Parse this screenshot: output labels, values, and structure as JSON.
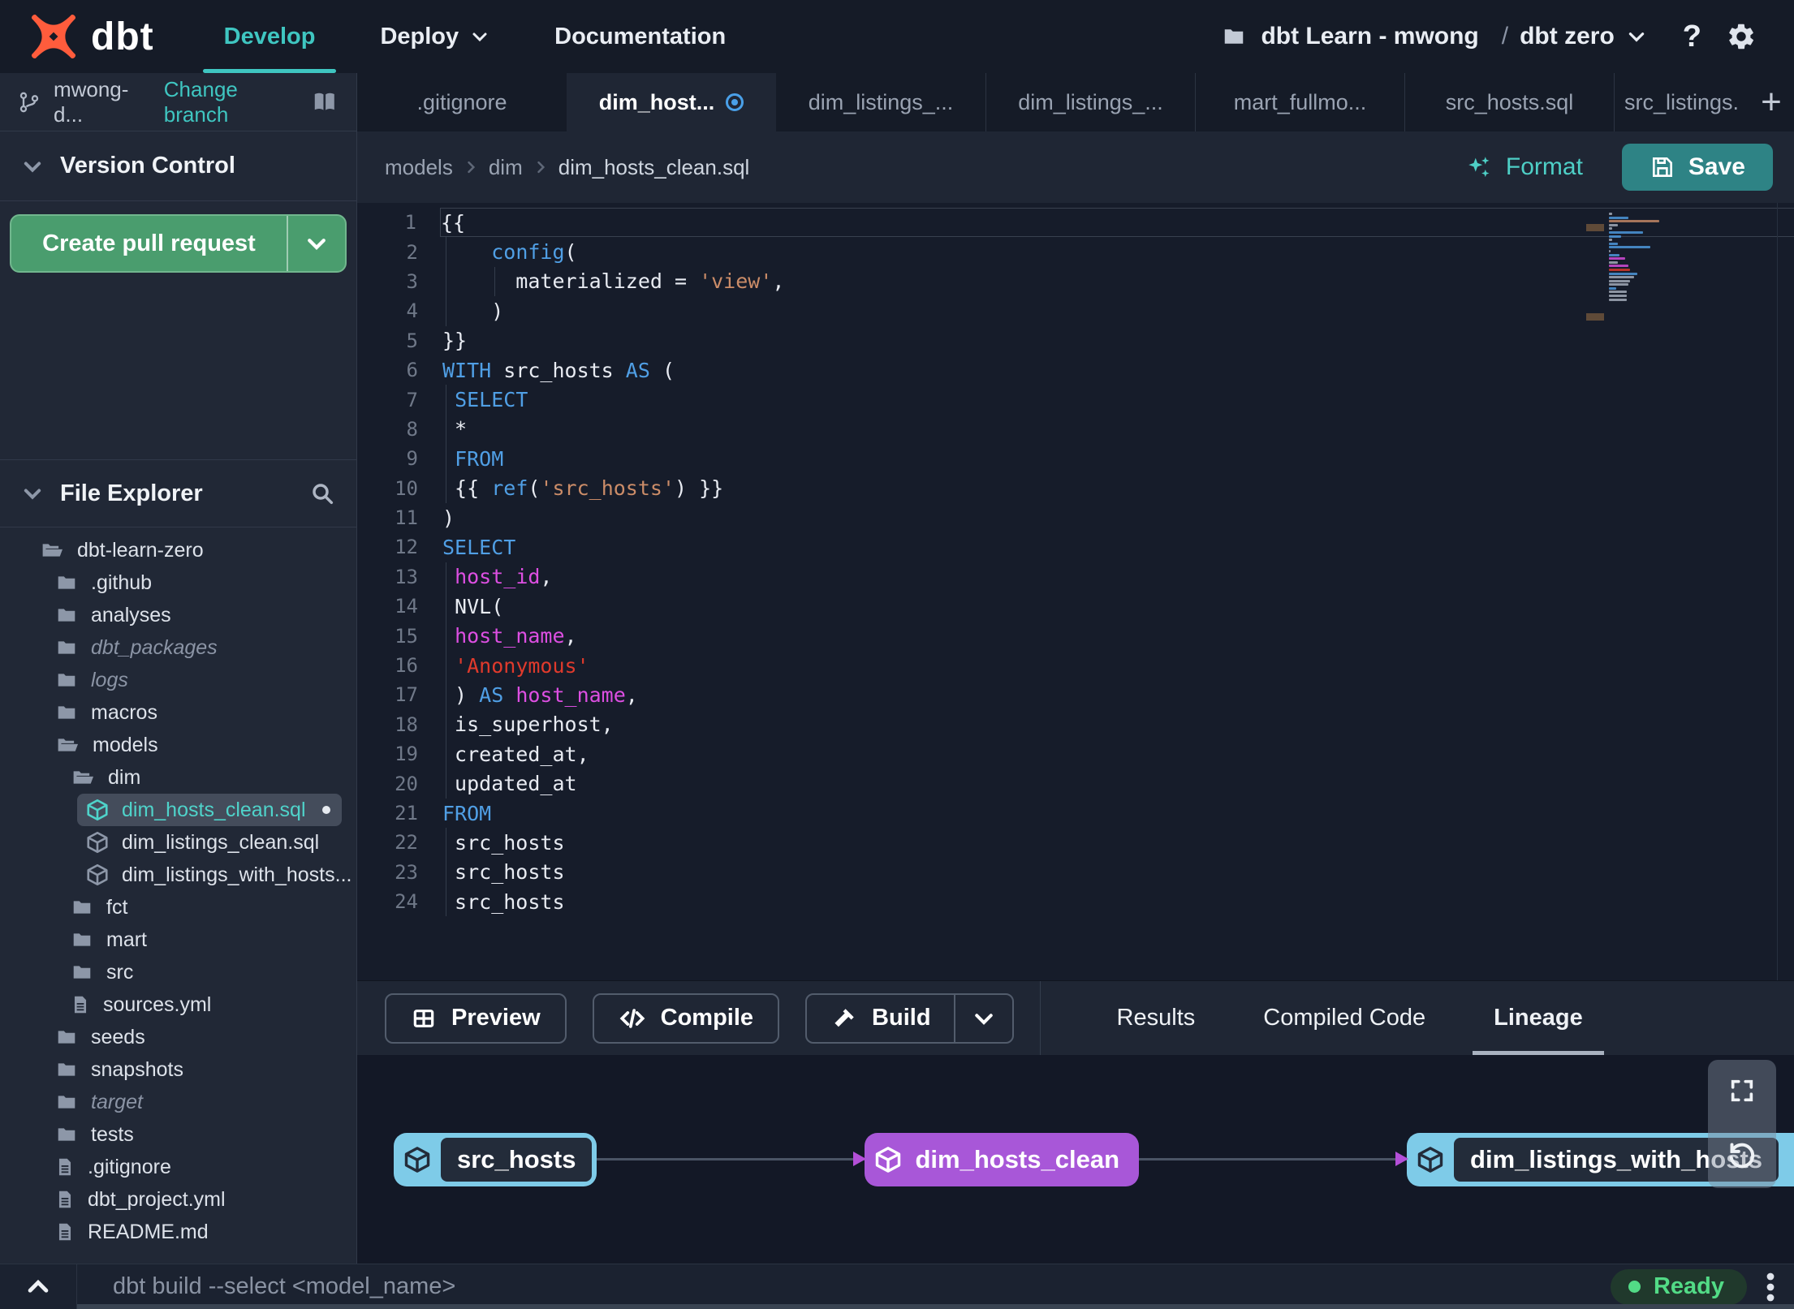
{
  "topnav": {
    "logo_text": "dbt",
    "items": [
      {
        "label": "Develop",
        "active": true
      },
      {
        "label": "Deploy",
        "dropdown": true
      },
      {
        "label": "Documentation"
      }
    ],
    "project_label": "dbt Learn - mwong",
    "separator": "/",
    "environment_label": "dbt zero",
    "help_label": "?"
  },
  "sidebar": {
    "branch_name": "mwong-d...",
    "change_branch_label": "Change branch",
    "version_control_title": "Version Control",
    "create_pr_label": "Create pull request",
    "file_explorer_title": "File Explorer",
    "tree": [
      {
        "label": "dbt-learn-zero",
        "icon": "folder-open",
        "level": 0
      },
      {
        "label": ".github",
        "icon": "folder",
        "level": 1
      },
      {
        "label": "analyses",
        "icon": "folder",
        "level": 1
      },
      {
        "label": "dbt_packages",
        "icon": "folder",
        "level": 1,
        "italic": true
      },
      {
        "label": "logs",
        "icon": "folder",
        "level": 1,
        "italic": true
      },
      {
        "label": "macros",
        "icon": "folder",
        "level": 1
      },
      {
        "label": "models",
        "icon": "folder-open",
        "level": 1
      },
      {
        "label": "dim",
        "icon": "folder-open",
        "level": 2
      },
      {
        "label": "dim_hosts_clean.sql",
        "icon": "model",
        "level": 3,
        "selected": true,
        "modified": true
      },
      {
        "label": "dim_listings_clean.sql",
        "icon": "model",
        "level": 3
      },
      {
        "label": "dim_listings_with_hosts...",
        "icon": "model",
        "level": 3
      },
      {
        "label": "fct",
        "icon": "folder",
        "level": 2
      },
      {
        "label": "mart",
        "icon": "folder",
        "level": 2
      },
      {
        "label": "src",
        "icon": "folder",
        "level": 2
      },
      {
        "label": "sources.yml",
        "icon": "file",
        "level": 2
      },
      {
        "label": "seeds",
        "icon": "folder",
        "level": 1
      },
      {
        "label": "snapshots",
        "icon": "folder",
        "level": 1
      },
      {
        "label": "target",
        "icon": "folder",
        "level": 1,
        "italic": true
      },
      {
        "label": "tests",
        "icon": "folder",
        "level": 1
      },
      {
        "label": ".gitignore",
        "icon": "file",
        "level": 1
      },
      {
        "label": "dbt_project.yml",
        "icon": "file",
        "level": 1
      },
      {
        "label": "README.md",
        "icon": "file",
        "level": 1
      }
    ]
  },
  "tabs": [
    {
      "label": ".gitignore"
    },
    {
      "label": "dim_host...",
      "active": true,
      "modified": true
    },
    {
      "label": "dim_listings_..."
    },
    {
      "label": "dim_listings_..."
    },
    {
      "label": "mart_fullmo..."
    },
    {
      "label": "src_hosts.sql"
    },
    {
      "label": "src_listings.",
      "clip": true
    }
  ],
  "new_tab_label": "+",
  "breadcrumb": [
    "models",
    "dim",
    "dim_hosts_clean.sql"
  ],
  "actions": {
    "format_label": "Format",
    "save_label": "Save"
  },
  "editor": {
    "lines": [
      {
        "n": 1,
        "active": true,
        "t": [
          [
            "p",
            "{{"
          ]
        ]
      },
      {
        "n": 2,
        "t": [
          [
            "g",
            "0"
          ],
          [
            "p",
            "    "
          ],
          [
            "k",
            "config"
          ],
          [
            "p",
            "("
          ]
        ]
      },
      {
        "n": 3,
        "t": [
          [
            "g",
            "0"
          ],
          [
            "g",
            "4"
          ],
          [
            "p",
            "      materialized = "
          ],
          [
            "s",
            "'view'"
          ],
          [
            "p",
            ","
          ]
        ]
      },
      {
        "n": 4,
        "t": [
          [
            "g",
            "0"
          ],
          [
            "p",
            "    )"
          ]
        ]
      },
      {
        "n": 5,
        "t": [
          [
            "p",
            "}}"
          ]
        ]
      },
      {
        "n": 6,
        "t": [
          [
            "k",
            "WITH"
          ],
          [
            "p",
            " src_hosts "
          ],
          [
            "k",
            "AS"
          ],
          [
            "p",
            " ("
          ]
        ]
      },
      {
        "n": 7,
        "t": [
          [
            "g",
            "0"
          ],
          [
            "p",
            " "
          ],
          [
            "k",
            "SELECT"
          ]
        ]
      },
      {
        "n": 8,
        "t": [
          [
            "g",
            "0"
          ],
          [
            "p",
            " *"
          ]
        ]
      },
      {
        "n": 9,
        "t": [
          [
            "g",
            "0"
          ],
          [
            "p",
            " "
          ],
          [
            "k",
            "FROM"
          ]
        ]
      },
      {
        "n": 10,
        "t": [
          [
            "g",
            "0"
          ],
          [
            "p",
            " {{ "
          ],
          [
            "k",
            "ref"
          ],
          [
            "p",
            "("
          ],
          [
            "s",
            "'src_hosts'"
          ],
          [
            "p",
            ") }}"
          ]
        ]
      },
      {
        "n": 11,
        "t": [
          [
            "p",
            ")"
          ]
        ]
      },
      {
        "n": 12,
        "t": [
          [
            "k",
            "SELECT"
          ]
        ]
      },
      {
        "n": 13,
        "t": [
          [
            "g",
            "0"
          ],
          [
            "p",
            " "
          ],
          [
            "m",
            "host_id"
          ],
          [
            "p",
            ","
          ]
        ]
      },
      {
        "n": 14,
        "t": [
          [
            "g",
            "0"
          ],
          [
            "p",
            " NVL("
          ]
        ]
      },
      {
        "n": 15,
        "t": [
          [
            "g",
            "0"
          ],
          [
            "p",
            " "
          ],
          [
            "m",
            "host_name"
          ],
          [
            "p",
            ","
          ]
        ]
      },
      {
        "n": 16,
        "t": [
          [
            "g",
            "0"
          ],
          [
            "p",
            " "
          ],
          [
            "r",
            "'Anonymous'"
          ]
        ]
      },
      {
        "n": 17,
        "t": [
          [
            "g",
            "0"
          ],
          [
            "p",
            " ) "
          ],
          [
            "k",
            "AS"
          ],
          [
            "p",
            " "
          ],
          [
            "m",
            "host_name"
          ],
          [
            "p",
            ","
          ]
        ]
      },
      {
        "n": 18,
        "t": [
          [
            "g",
            "0"
          ],
          [
            "p",
            " is_superhost,"
          ]
        ]
      },
      {
        "n": 19,
        "t": [
          [
            "g",
            "0"
          ],
          [
            "p",
            " created_at,"
          ]
        ]
      },
      {
        "n": 20,
        "t": [
          [
            "g",
            "0"
          ],
          [
            "p",
            " updated_at"
          ]
        ]
      },
      {
        "n": 21,
        "t": [
          [
            "k",
            "FROM"
          ]
        ]
      },
      {
        "n": 22,
        "t": [
          [
            "g",
            "0"
          ],
          [
            "p",
            " src_hosts"
          ]
        ]
      },
      {
        "n": 23,
        "t": [
          [
            "g",
            "0"
          ],
          [
            "p",
            " src_hosts"
          ]
        ]
      },
      {
        "n": 24,
        "t": [
          [
            "g",
            "0"
          ],
          [
            "p",
            " src_hosts"
          ]
        ]
      }
    ]
  },
  "panel": {
    "preview_label": "Preview",
    "compile_label": "Compile",
    "build_label": "Build",
    "tabs": [
      {
        "label": "Results"
      },
      {
        "label": "Compiled Code"
      },
      {
        "label": "Lineage",
        "active": true
      }
    ]
  },
  "lineage": {
    "nodes": [
      {
        "label": "src_hosts",
        "style": "source"
      },
      {
        "label": "dim_hosts_clean",
        "style": "selected"
      },
      {
        "label": "dim_listings_with_hosts",
        "style": "source",
        "clipped": true
      }
    ]
  },
  "statusbar": {
    "command_placeholder": "dbt build --select <model_name>",
    "status_label": "Ready"
  },
  "colors": {
    "accent_teal": "#3fc6c1",
    "save_teal": "#2e8385",
    "pr_green": "#4a9d6e",
    "ready_green": "#52db86",
    "node_cyan": "#7ecbe8",
    "node_purple": "#a857d8",
    "tab_modified_blue": "#4aa0e8",
    "code_keyword": "#509fe5",
    "code_string": "#cb8c68",
    "code_string_red": "#e03a2c",
    "code_identifier": "#dd4fe2"
  }
}
